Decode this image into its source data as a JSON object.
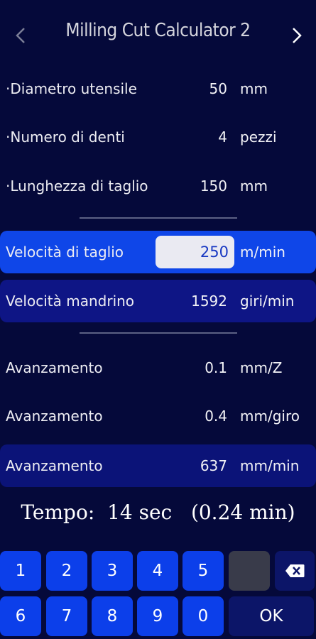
{
  "header": {
    "title": "Milling Cut Calculator 2",
    "prev_icon": "chevron-left-icon",
    "next_icon": "chevron-right-icon"
  },
  "rows": {
    "diameter": {
      "label": "·Diametro utensile",
      "value": "50",
      "unit": "mm"
    },
    "teeth": {
      "label": "·Numero di denti",
      "value": "4",
      "unit": "pezzi"
    },
    "length": {
      "label": "·Lunghezza di taglio",
      "value": "150",
      "unit": "mm"
    },
    "cut_speed": {
      "label": "Velocità di taglio",
      "value": "250",
      "unit": "m/min"
    },
    "spindle": {
      "label": "Velocità mandrino",
      "value": "1592",
      "unit": "giri/min"
    },
    "feed_tooth": {
      "label": "Avanzamento",
      "value": "0.1",
      "unit": "mm/Z"
    },
    "feed_rev": {
      "label": "Avanzamento",
      "value": "0.4",
      "unit": "mm/giro"
    },
    "feed_min": {
      "label": "Avanzamento",
      "value": "637",
      "unit": "mm/min"
    }
  },
  "time": {
    "label": "Tempo:",
    "seconds": "14 sec",
    "minutes": "(0.24 min)"
  },
  "keypad": {
    "row1": [
      "1",
      "2",
      "3",
      "4",
      "5"
    ],
    "row2": [
      "6",
      "7",
      "8",
      "9",
      "0"
    ],
    "ok_label": "OK",
    "backspace_icon": "backspace-icon"
  },
  "colors": {
    "background": "#05093a",
    "active_row": "#0f46e8",
    "result_row": "#0e1585",
    "key": "#0c3fea",
    "key_dark": "#0c1568"
  }
}
